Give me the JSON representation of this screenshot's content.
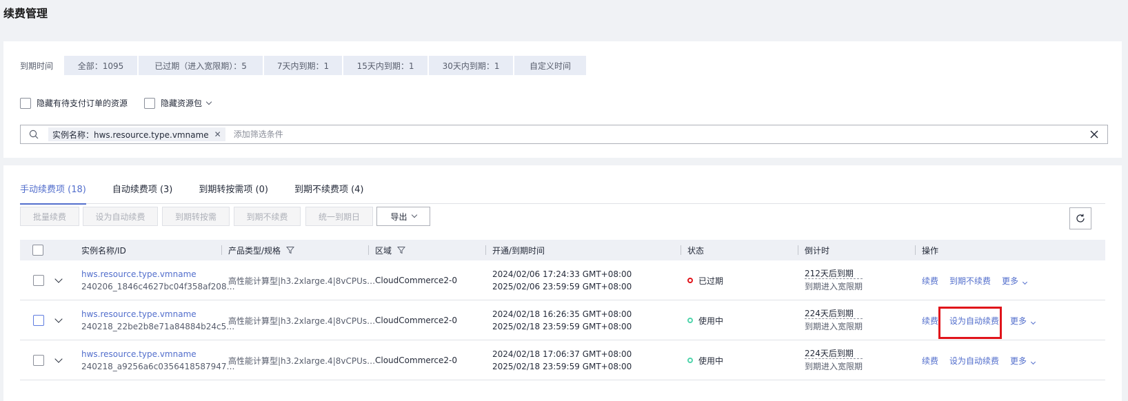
{
  "page": {
    "title": "续费管理"
  },
  "filter": {
    "due_label": "到期时间",
    "due_options": [
      {
        "label": "全部：1095"
      },
      {
        "label": "已过期（进入宽限期）：5"
      },
      {
        "label": "7天内到期：1"
      },
      {
        "label": "15天内到期：1"
      },
      {
        "label": "30天内到期：1"
      },
      {
        "label": "自定义时间"
      }
    ],
    "checkboxes": {
      "hide_pending": "隐藏有待支付订单的资源",
      "hide_package": "隐藏资源包"
    },
    "search": {
      "tag": "实例名称：hws.resource.type.vmname",
      "placeholder": "添加筛选条件"
    }
  },
  "tabs": [
    {
      "label": "手动续费项 (18)",
      "active": true
    },
    {
      "label": "自动续费项 (3)"
    },
    {
      "label": "到期转按需项 (0)"
    },
    {
      "label": "到期不续费项 (4)"
    }
  ],
  "toolbar": {
    "batch_renew": "批量续费",
    "set_auto": "设为自动续费",
    "to_ondemand": "到期转按需",
    "no_renew": "到期不续费",
    "unify_date": "统一到期日",
    "export": "导出"
  },
  "table": {
    "columns": {
      "name": "实例名称/ID",
      "product": "产品类型/规格",
      "region": "区域",
      "time": "开通/到期时间",
      "status": "状态",
      "countdown": "倒计时",
      "ops": "操作"
    },
    "rows": [
      {
        "name": "hws.resource.type.vmname",
        "id": "240206_1846c4627bc04f358af208…",
        "product": "高性能计算型|h3.2xlarge.4|8vCPUs…",
        "region": "CloudCommerce2-0",
        "open_time": "2024/02/06 17:24:33 GMT+08:00",
        "expire_time": "2025/02/06 23:59:59 GMT+08:00",
        "status": "已过期",
        "status_color": "#e0131a",
        "countdown": "212天后到期",
        "countdown_sub": "到期进入宽限期",
        "op1": "续费",
        "op2": "到期不续费",
        "op3": "更多"
      },
      {
        "name": "hws.resource.type.vmname",
        "id": "240218_22be2b8e71a84884b24c5…",
        "product": "高性能计算型|h3.2xlarge.4|8vCPUs…",
        "region": "CloudCommerce2-0",
        "open_time": "2024/02/18 16:26:35 GMT+08:00",
        "expire_time": "2025/02/18 23:59:59 GMT+08:00",
        "status": "使用中",
        "status_color": "#50d4ab",
        "countdown": "224天后到期",
        "countdown_sub": "到期进入宽限期",
        "op1": "续费",
        "op2": "设为自动续费",
        "op3": "更多"
      },
      {
        "name": "hws.resource.type.vmname",
        "id": "240218_a9256a6c0356418587947…",
        "product": "高性能计算型|h3.2xlarge.4|8vCPUs…",
        "region": "CloudCommerce2-0",
        "open_time": "2024/02/18 17:06:37 GMT+08:00",
        "expire_time": "2025/02/18 23:59:59 GMT+08:00",
        "status": "使用中",
        "status_color": "#50d4ab",
        "countdown": "224天后到期",
        "countdown_sub": "到期进入宽限期",
        "op1": "续费",
        "op2": "设为自动续费",
        "op3": "更多"
      }
    ]
  },
  "colors": {
    "accent": "#526ecc",
    "highlight": "#e0131a",
    "running": "#50d4ab"
  }
}
